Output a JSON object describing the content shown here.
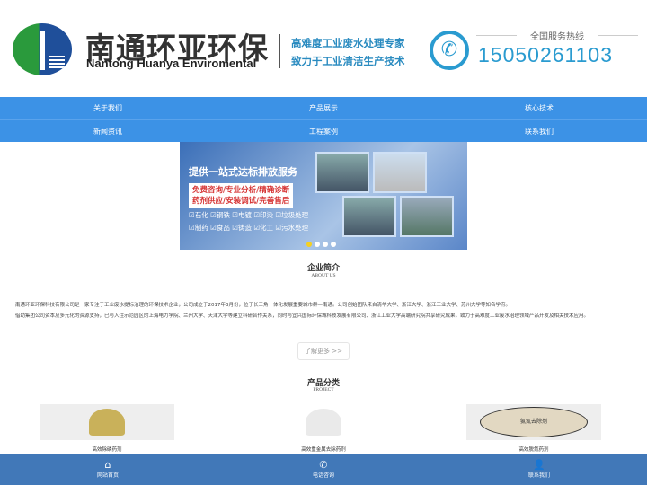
{
  "header": {
    "brand_cn": "南通环亚环保",
    "brand_en": "Nantong Huanya Enviromental",
    "slogan1": "高难度工业废水处理专家",
    "slogan2": "致力于工业清洁生产技术",
    "hotline_label": "全国服务热线",
    "hotline": "15050261103"
  },
  "nav": {
    "row1": [
      "关于我们",
      "产品展示",
      "核心技术"
    ],
    "row2": [
      "新闻资讯",
      "工程案例",
      "联系我们"
    ]
  },
  "banner": {
    "title": "提供一站式达标排放服务",
    "box1": "免费咨询/专业分析/精确诊断",
    "box2": "药剂供应/安装调试/完善售后",
    "tags1": "☑石化 ☑钢铁 ☑电镀 ☑印染 ☑垃圾处理",
    "tags2": "☑制药 ☑食品 ☑铸造 ☑化工 ☑污水处理",
    "slides": 4,
    "active_slide": 1
  },
  "about": {
    "title": "企业简介",
    "subtitle": "ABOUT US",
    "line1": "南通环亚环保科技有限公司是一家专注于工业废水提标治理的环保技术企业，公司成立于2017年3月份，位于长三角一体化发展重要城市群—南通。公司创始团队来自清华大学、浙江大学、浙江工业大学、苏州大学等知名学府。",
    "line2": "借助集团公司资本及多元化的资源支持，已与入住示范园区的上海电力学院、兰州大学、天津大学等建立科研合作关系，同时与宜兴国际环保城科技发展有限公司、浙江工业大学高端研究院共享研究成果，致力于高难度工业废水治理领域产品开发及相关技术应用。",
    "more": "了解更多 >>"
  },
  "products": {
    "title": "产品分类",
    "subtitle": "PROJECT",
    "items": [
      {
        "name": "高效除磷药剂",
        "color": "#c9b15a"
      },
      {
        "name": "高效重金属去除药剂",
        "color": "#f2f2f2"
      },
      {
        "name": "高效脱氮药剂",
        "color": "#e2d8c2",
        "label": "氨氮去除剂"
      }
    ]
  },
  "footer": {
    "items": [
      {
        "label": "网站首页",
        "icon": "home-icon"
      },
      {
        "label": "电话咨询",
        "icon": "phone-icon"
      },
      {
        "label": "联系我们",
        "icon": "user-icon"
      }
    ]
  }
}
